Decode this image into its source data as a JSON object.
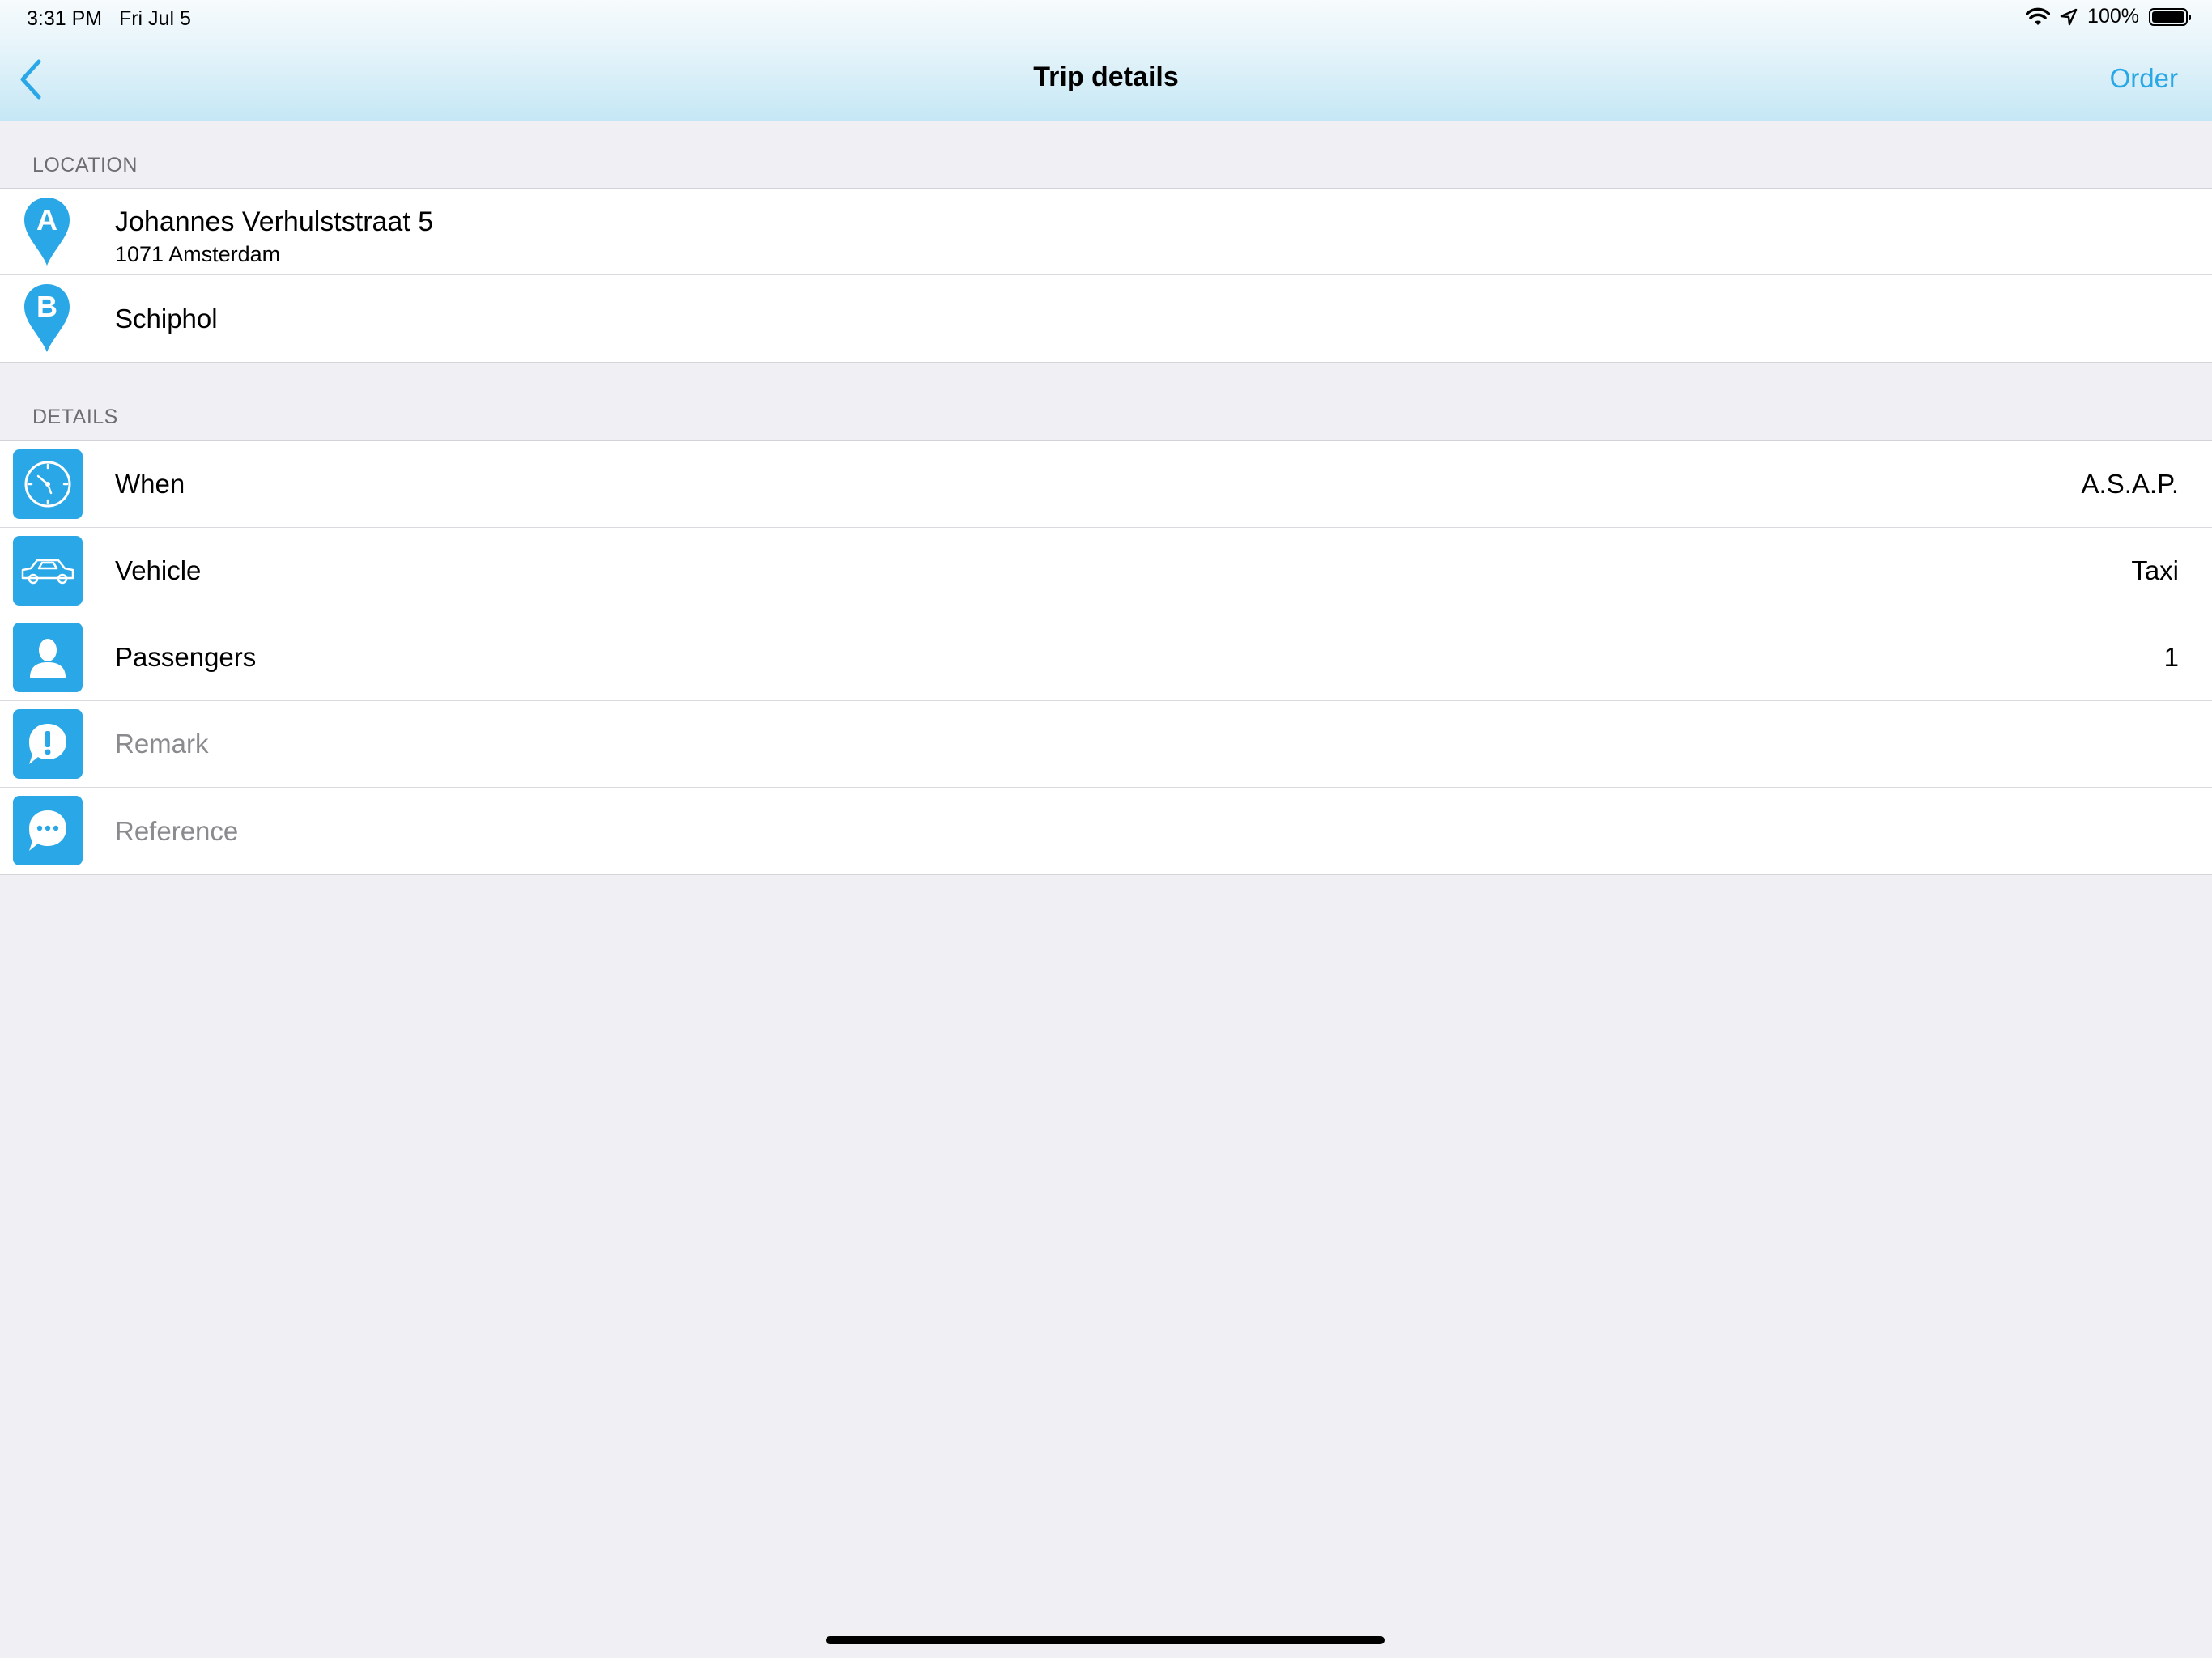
{
  "status": {
    "time": "3:31 PM",
    "date": "Fri Jul 5",
    "battery": "100%"
  },
  "nav": {
    "title": "Trip details",
    "order_label": "Order"
  },
  "location": {
    "header": "LOCATION",
    "from": {
      "pin": "A",
      "line1": "Johannes Verhulststraat 5",
      "line2": "1071 Amsterdam"
    },
    "to": {
      "pin": "B",
      "line1": "Schiphol"
    }
  },
  "details": {
    "header": "DETAILS",
    "when": {
      "label": "When",
      "value": "A.S.A.P.",
      "icon": "clock-icon"
    },
    "vehicle": {
      "label": "Vehicle",
      "value": "Taxi",
      "icon": "car-icon"
    },
    "passengers": {
      "label": "Passengers",
      "value": "1",
      "icon": "person-icon"
    },
    "remark": {
      "label": "Remark",
      "icon": "exclamation-bubble-icon"
    },
    "reference": {
      "label": "Reference",
      "icon": "chat-bubble-icon"
    }
  },
  "colors": {
    "accent": "#2aa7e6",
    "background": "#efeff4"
  }
}
